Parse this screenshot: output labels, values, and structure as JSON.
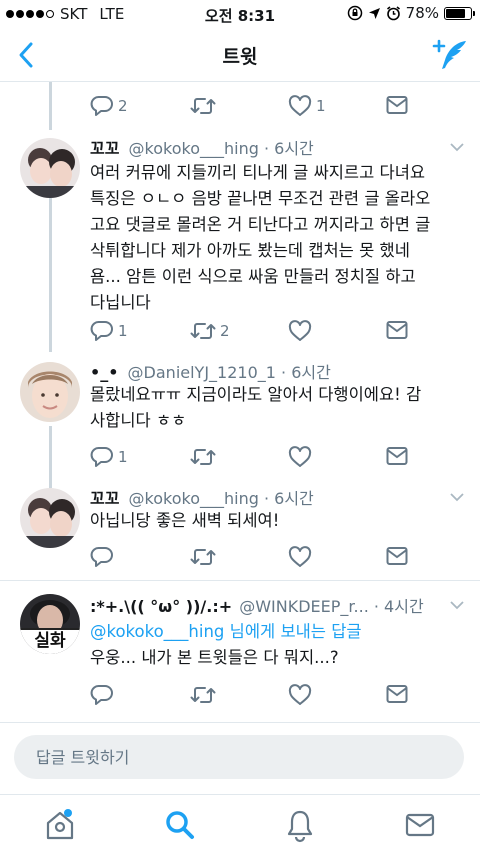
{
  "status_bar": {
    "carrier": "SKT",
    "network": "LTE",
    "time": "오전 8:31",
    "battery_text": "78%",
    "battery_level": 0.78
  },
  "nav": {
    "title": "트윗"
  },
  "top_actions": {
    "reply_count": "2",
    "retweet_count": "",
    "like_count": "1"
  },
  "tweets": [
    {
      "name": "꼬꼬",
      "handle": "@kokoko___hing",
      "time": " · 6시간",
      "lines": [
        "여러 커뮤에 지들끼리 티나게 글 싸지르고 다녀요",
        "특징은 ㅇㄴㅇ 음방 끝나면 무조건 관련 글 올라오",
        "고요 댓글로 몰려온 거 티난다고 꺼지라고 하면 글",
        "삭튀합니다 제가 아까도 봤는데 캡처는 못 했네",
        "욤... 암튼 이런 식으로 싸움 만들러 정치질 하고",
        "다닙니다"
      ],
      "reply_count": "1",
      "retweet_count": "2",
      "like_count": ""
    },
    {
      "name": "•_•",
      "handle": "@DanielYJ_1210_1",
      "time": " · 6시간",
      "lines": [
        "몰랐네요ㅠㅠ 지금이라도 알아서 다행이에요! 감",
        "사합니다 ㅎㅎ"
      ],
      "reply_count": "1",
      "retweet_count": "",
      "like_count": ""
    },
    {
      "name": "꼬꼬",
      "handle": "@kokoko___hing",
      "time": " · 6시간",
      "lines": [
        "아닙니당 좋은 새벽 되세여!"
      ],
      "reply_count": "",
      "retweet_count": "",
      "like_count": ""
    },
    {
      "name": ":*+.\\(( °ω° ))/.:+",
      "handle": "@WINKDEEP_r...",
      "time": " · 4시간",
      "reply_to_handle": "@kokoko___hing",
      "reply_to_suffix": " 님에게 보내는 답글",
      "avatar_text": "실화",
      "lines": [
        "우웅... 내가 본 트윗들은 다 뭐지...?"
      ],
      "reply_count": "",
      "retweet_count": "",
      "like_count": ""
    }
  ],
  "reply_bar": {
    "placeholder": "답글 트윗하기"
  },
  "tab_bar": {
    "items": [
      "home-icon",
      "search-icon",
      "notifications-icon",
      "messages-icon"
    ]
  },
  "colors": {
    "accent": "#1da1f2",
    "secondary_text": "#657786",
    "divider": "#e1e8ed"
  }
}
